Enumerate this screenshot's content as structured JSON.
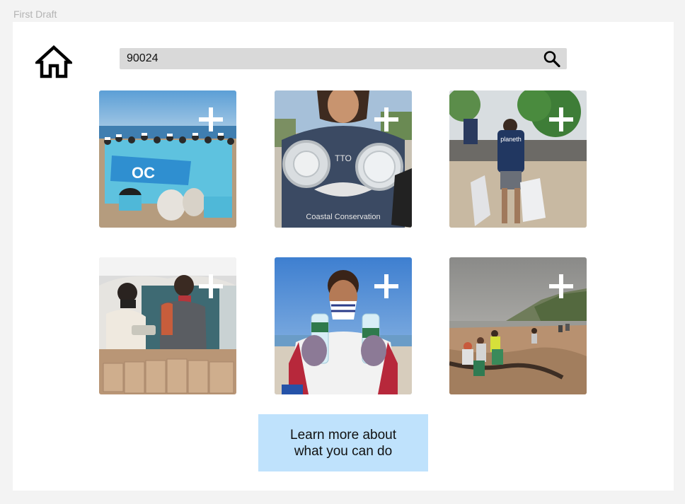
{
  "frame": {
    "label": "First Draft"
  },
  "header": {
    "home_icon": "home-icon",
    "search": {
      "value": "90024",
      "icon": "search-icon"
    }
  },
  "gallery": {
    "add_icon": "plus-icon",
    "items": [
      {
        "description": "group of volunteers in blue shirts holding a banner on the beach",
        "banner_text": "OC"
      },
      {
        "description": "person holding two plastic lids",
        "shirt_text": "Coastal Conservation"
      },
      {
        "description": "volunteers carrying trash bags on a sandy beach",
        "shirt_text": "planeth"
      },
      {
        "description": "volunteers packing paper bags under a tent"
      },
      {
        "description": "person in mask holding two plastic bottles"
      },
      {
        "description": "volunteers cleaning up a beach under grey sky"
      }
    ]
  },
  "cta": {
    "line1": "Learn more about",
    "line2": "what you can do"
  }
}
